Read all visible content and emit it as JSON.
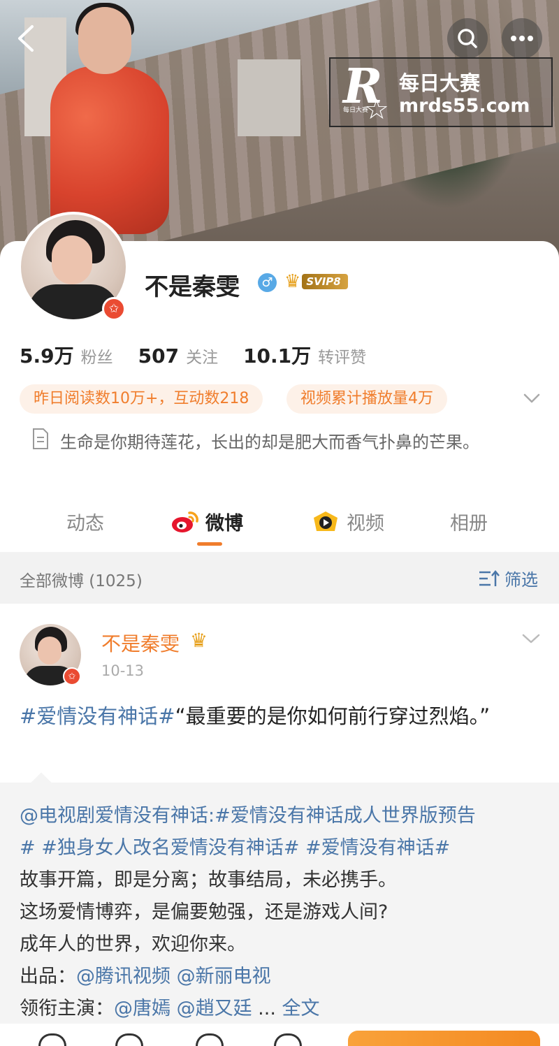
{
  "watermark": {
    "logo_letter": "R",
    "logo_small": "每日大赛",
    "title": "每日大赛",
    "url": "mrds55.com"
  },
  "profile": {
    "name": "不是秦雯",
    "svip_label": "SVIP8",
    "stats": [
      {
        "num": "5.9万",
        "label": "粉丝"
      },
      {
        "num": "507",
        "label": "关注"
      },
      {
        "num": "10.1万",
        "label": "转评赞"
      }
    ],
    "pills": [
      "昨日阅读数10万+，互动数218",
      "视频累计播放量4万"
    ],
    "bio": "生命是你期待莲花，长出的却是肥大而香气扑鼻的芒果。"
  },
  "tabs": [
    {
      "label": "动态",
      "icon": "none",
      "active": false
    },
    {
      "label": "微博",
      "icon": "weibo-logo",
      "active": true
    },
    {
      "label": "视频",
      "icon": "video-play",
      "active": false
    },
    {
      "label": "相册",
      "icon": "none",
      "active": false
    }
  ],
  "filterbar": {
    "count_label": "全部微博 (1025)",
    "filter_label": "筛选"
  },
  "post": {
    "author": "不是秦雯",
    "date": "10-13",
    "topic": "#爱情没有神话#",
    "text": "“最重要的是你如何前行穿过烈焰。”",
    "repost": {
      "line1_link": "@电视剧爱情没有神话",
      "line1_rest": ":#爱情没有神话成人世界版预告",
      "line2": "# #独身女人改名爱情没有神话# #爱情没有神话#",
      "line3": "故事开篇，即是分离；故事结局，未必携手。",
      "line4": "这场爱情博弈，是偏要勉强，还是游戏人间?",
      "line5": "成年人的世界，欢迎你来。",
      "produce_label": "出品：",
      "produce_links": "@腾讯视频 @新丽电视",
      "cast_label": "领衔主演：",
      "cast_links": "@唐嫣 @趙又廷",
      "ellipsis": " ...",
      "full_text": "全文"
    }
  },
  "colors": {
    "accent_orange": "#f07d2c",
    "link_blue": "#4a76a8",
    "verified_red": "#ea4b32",
    "male_blue": "#58a9e6"
  }
}
